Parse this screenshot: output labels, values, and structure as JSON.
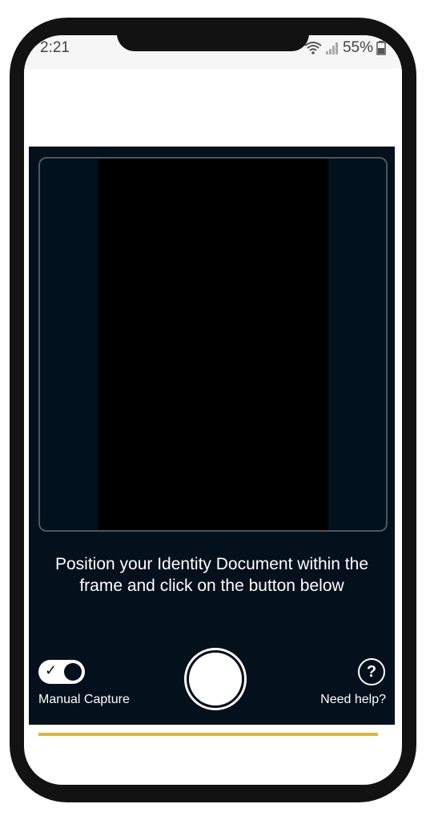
{
  "status_bar": {
    "time": "2:21",
    "battery": "55%",
    "wifi_icon": "wifi-icon",
    "signal_icon": "signal-icon",
    "battery_icon": "battery-icon"
  },
  "capture": {
    "instruction": "Position your Identity Document within the frame and click on the button below",
    "manual_capture_label": "Manual Capture",
    "manual_capture_enabled": true,
    "help_label": "Need help?",
    "help_icon": "?",
    "toggle_check": "✓"
  },
  "colors": {
    "panel_background": "#04101c",
    "camera_feed": "#000000",
    "accent_strip": "#d9b64a"
  }
}
